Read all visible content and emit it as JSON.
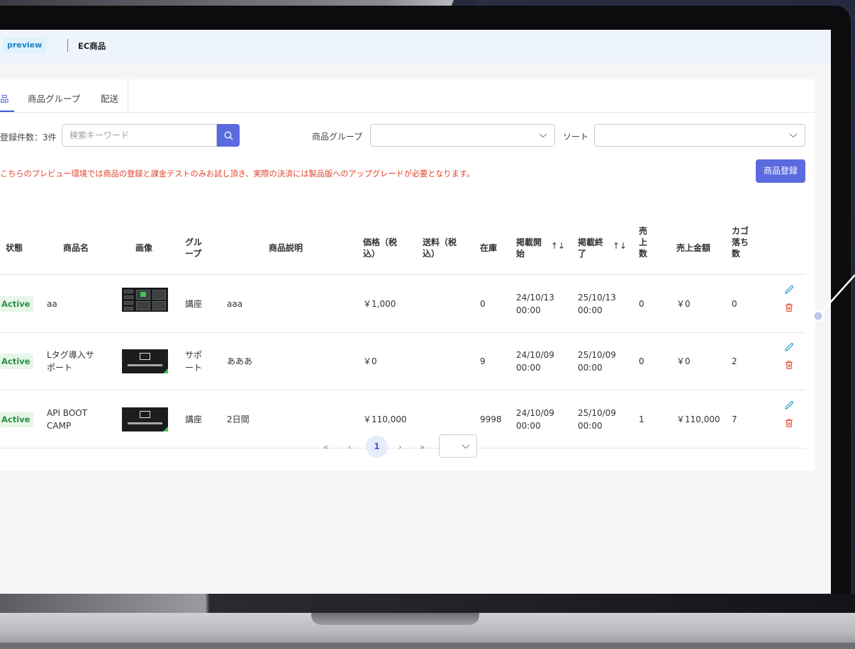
{
  "header": {
    "preview_badge": "preview",
    "title": "EC商品"
  },
  "tabs": [
    {
      "label": "品"
    },
    {
      "label": "商品グループ"
    },
    {
      "label": "配送"
    }
  ],
  "filters": {
    "count_label": "登録件数：3件",
    "search_placeholder": "検索キーワード",
    "group_label": "商品グループ",
    "group_value": "",
    "sort_label": "ソート",
    "sort_value": ""
  },
  "notice": "こちらのプレビュー環境では商品の登録と課金テストのみお試し頂き、実際の決済には製品版へのアップグレードが必要となります。",
  "register_button": "商品登録",
  "table": {
    "headers": {
      "status": "状態",
      "name": "商品名",
      "image": "画像",
      "group": [
        "グル",
        "ープ"
      ],
      "description": "商品説明",
      "price": [
        "価格（税",
        "込）"
      ],
      "shipping": [
        "送料（税",
        "込）"
      ],
      "stock": "在庫",
      "start": [
        "掲載開",
        "始"
      ],
      "end": [
        "掲載終",
        "了"
      ],
      "sold": [
        "売",
        "上",
        "数"
      ],
      "sales_amount": "売上金額",
      "abandoned": [
        "カゴ",
        "落ち",
        "数"
      ]
    },
    "rows": [
      {
        "status": "Active",
        "name": [
          "aa"
        ],
        "image": "course-screenshot-thumbnail",
        "group": [
          "講座"
        ],
        "description": "aaa",
        "price": "￥1,000",
        "shipping": "",
        "stock": "0",
        "start": [
          "24/10/13",
          "00:00"
        ],
        "end": [
          "25/10/13",
          "00:00"
        ],
        "sold": "0",
        "sales_amount": "￥0",
        "abandoned": "0"
      },
      {
        "status": "Active",
        "name": [
          "Lタグ導入サ",
          "ポート"
        ],
        "image": "api-boot-camp-logo-thumbnail",
        "group": [
          "サポ",
          "ート"
        ],
        "description": "あああ",
        "price": "￥0",
        "shipping": "",
        "stock": "9",
        "start": [
          "24/10/09",
          "00:00"
        ],
        "end": [
          "25/10/09",
          "00:00"
        ],
        "sold": "0",
        "sales_amount": "￥0",
        "abandoned": "2"
      },
      {
        "status": "Active",
        "name": [
          "API BOOT",
          "CAMP"
        ],
        "image": "api-boot-camp-logo-thumbnail",
        "group": [
          "講座"
        ],
        "description": "2日間",
        "price": "￥110,000",
        "shipping": "",
        "stock": "9998",
        "start": [
          "24/10/09",
          "00:00"
        ],
        "end": [
          "25/10/09",
          "00:00"
        ],
        "sold": "1",
        "sales_amount": "￥110,000",
        "abandoned": "7"
      }
    ]
  },
  "pagination": {
    "first": "«",
    "prev": "‹",
    "current": "1",
    "next": "›",
    "last": "»",
    "page_size": ""
  },
  "colors": {
    "accent": "#5b6bdf",
    "tab_active": "#3d5bd9",
    "notice_red": "#e0442e",
    "status_green": "#2c9140",
    "delete_red": "#e0442e",
    "edit_blue": "#1a8fd1"
  }
}
